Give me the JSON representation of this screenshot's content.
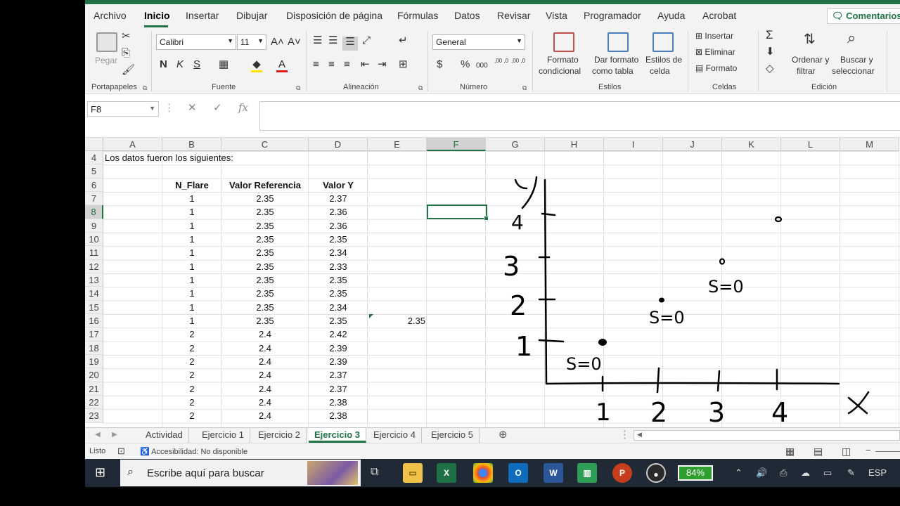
{
  "menu": {
    "items": [
      "Archivo",
      "Inicio",
      "Insertar",
      "Dibujar",
      "Disposición de página",
      "Fórmulas",
      "Datos",
      "Revisar",
      "Vista",
      "Programador",
      "Ayuda",
      "Acrobat"
    ],
    "active": "Inicio",
    "comments_label": "Comentarios"
  },
  "ribbon": {
    "clipboard": {
      "paste_label": "Pegar",
      "group_label": "Portapapeles"
    },
    "font": {
      "name": "Calibri",
      "size": "11",
      "bold": "N",
      "italic": "K",
      "underline": "S",
      "group_label": "Fuente"
    },
    "alignment": {
      "group_label": "Alineación"
    },
    "number": {
      "format": "General",
      "group_label": "Número",
      "decimal_inc": ",00 ,0",
      "decimal_dec": ",00 ,0"
    },
    "styles": {
      "conditional_l1": "Formato",
      "conditional_l2": "condicional",
      "table_l1": "Dar formato",
      "table_l2": "como tabla",
      "cell_l1": "Estilos de",
      "cell_l2": "celda",
      "group_label": "Estilos"
    },
    "cells": {
      "insert": "Insertar",
      "delete": "Eliminar",
      "format": "Formato",
      "group_label": "Celdas"
    },
    "editing": {
      "sort_l1": "Ordenar y",
      "sort_l2": "filtrar",
      "find_l1": "Buscar y",
      "find_l2": "seleccionar",
      "group_label": "Edición"
    }
  },
  "formula_bar": {
    "name_box": "F8",
    "fx": "fx",
    "value": ""
  },
  "columns": [
    "A",
    "B",
    "C",
    "D",
    "E",
    "F",
    "G",
    "H",
    "I",
    "J",
    "K",
    "L",
    "M"
  ],
  "rows": [
    "4",
    "5",
    "6",
    "7",
    "8",
    "9",
    "10",
    "11",
    "12",
    "13",
    "14",
    "15",
    "16",
    "17",
    "18",
    "19",
    "20",
    "21",
    "22",
    "23"
  ],
  "sheet": {
    "intro": "Los datos fueron los siguientes:",
    "headers": [
      "N_Flare",
      "Valor Referencia",
      "Valor Y"
    ],
    "data": [
      [
        "1",
        "2.35",
        "2.37"
      ],
      [
        "1",
        "2.35",
        "2.36"
      ],
      [
        "1",
        "2.35",
        "2.36"
      ],
      [
        "1",
        "2.35",
        "2.35"
      ],
      [
        "1",
        "2.35",
        "2.34"
      ],
      [
        "1",
        "2.35",
        "2.33"
      ],
      [
        "1",
        "2.35",
        "2.35"
      ],
      [
        "1",
        "2.35",
        "2.35"
      ],
      [
        "1",
        "2.35",
        "2.34"
      ],
      [
        "1",
        "2.35",
        "2.35"
      ],
      [
        "2",
        "2.4",
        "2.42"
      ],
      [
        "2",
        "2.4",
        "2.39"
      ],
      [
        "2",
        "2.4",
        "2.39"
      ],
      [
        "2",
        "2.4",
        "2.37"
      ],
      [
        "2",
        "2.4",
        "2.37"
      ],
      [
        "2",
        "2.4",
        "2.38"
      ],
      [
        "2",
        "2.4",
        "2.38"
      ]
    ],
    "e16": "2.35"
  },
  "sketch": {
    "y_label": "y",
    "x_label": "X",
    "y_ticks": [
      "1",
      "2",
      "3",
      "4"
    ],
    "x_ticks": [
      "1",
      "2",
      "3",
      "4"
    ],
    "annotations": [
      "S=0",
      "S=0",
      "S=0"
    ]
  },
  "tabs": [
    "Actividad",
    "Ejercicio 1",
    "Ejercicio 2",
    "Ejercicio 3",
    "Ejercicio 4",
    "Ejercicio 5"
  ],
  "active_tab": "Ejercicio 3",
  "status": {
    "ready": "Listo",
    "accessibility": "Accesibilidad: No disponible"
  },
  "taskbar": {
    "search_placeholder": "Escribe aquí para buscar",
    "battery": "84%",
    "lang": "ESP"
  }
}
